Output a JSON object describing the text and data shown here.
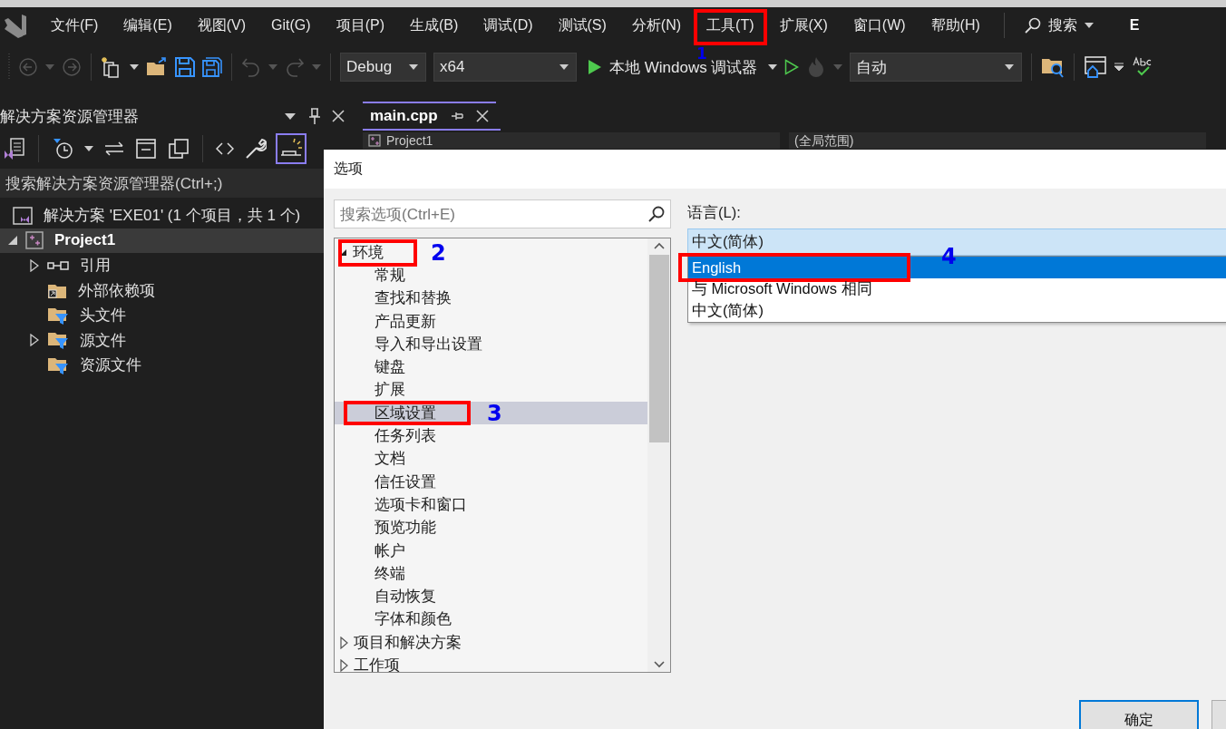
{
  "menu": {
    "items": [
      {
        "label": "文件(F)"
      },
      {
        "label": "编辑(E)"
      },
      {
        "label": "视图(V)"
      },
      {
        "label": "Git(G)"
      },
      {
        "label": "项目(P)"
      },
      {
        "label": "生成(B)"
      },
      {
        "label": "调试(D)"
      },
      {
        "label": "测试(S)"
      },
      {
        "label": "分析(N)"
      },
      {
        "label": "工具(T)",
        "callout": "1"
      },
      {
        "label": "扩展(X)"
      },
      {
        "label": "窗口(W)"
      },
      {
        "label": "帮助(H)"
      }
    ],
    "search": "搜索",
    "title": "E"
  },
  "toolbar": {
    "configuration": "Debug",
    "platform": "x64",
    "run_label": "本地 Windows 调试器",
    "target": "自动"
  },
  "solution_explorer": {
    "title": "解决方案资源管理器",
    "search": {
      "placeholder": "搜索解决方案资源管理器(Ctrl+;)"
    },
    "tree": [
      {
        "label": "解决方案 'EXE01' (1 个项目，共 1 个)",
        "kind": "solution",
        "selected": false,
        "children": [
          {
            "label": "Project1",
            "kind": "project",
            "expanded": true,
            "selected": true,
            "children": [
              {
                "label": "引用",
                "kind": "reference",
                "expanded": false,
                "selected": false
              },
              {
                "label": "外部依赖项",
                "kind": "external",
                "selected": false
              },
              {
                "label": "头文件",
                "kind": "filter",
                "selected": false
              },
              {
                "label": "源文件",
                "kind": "filter",
                "expanded": false,
                "selected": false
              },
              {
                "label": "资源文件",
                "kind": "filter",
                "selected": false
              }
            ]
          }
        ]
      }
    ]
  },
  "editor": {
    "tabs": [
      {
        "label": "main.cpp",
        "selected": true
      }
    ],
    "navigation": [
      "Project1",
      "(全局范围)"
    ]
  },
  "options_dialog": {
    "title": "选项",
    "search": {
      "placeholder": "搜索选项(Ctrl+E)"
    },
    "tree": [
      {
        "label": "环境",
        "expanded": true,
        "selected": false,
        "callout": "2",
        "children": [
          {
            "label": "常规",
            "selected": false
          },
          {
            "label": "查找和替换",
            "selected": false
          },
          {
            "label": "产品更新",
            "selected": false
          },
          {
            "label": "导入和导出设置",
            "selected": false
          },
          {
            "label": "键盘",
            "selected": false
          },
          {
            "label": "扩展",
            "selected": false
          },
          {
            "label": "区域设置",
            "selected": true,
            "callout": "3"
          },
          {
            "label": "任务列表",
            "selected": false
          },
          {
            "label": "文档",
            "selected": false
          },
          {
            "label": "信任设置",
            "selected": false
          },
          {
            "label": "选项卡和窗口",
            "selected": false
          },
          {
            "label": "预览功能",
            "selected": false
          },
          {
            "label": "帐户",
            "selected": false
          },
          {
            "label": "终端",
            "selected": false
          },
          {
            "label": "自动恢复",
            "selected": false
          },
          {
            "label": "字体和颜色",
            "selected": false
          }
        ]
      },
      {
        "label": "项目和解决方案",
        "expanded": false,
        "selected": false
      },
      {
        "label": "工作项",
        "expanded": false,
        "selected": false
      }
    ],
    "language": {
      "label": "语言(L):",
      "value": "中文(简体)",
      "options": [
        {
          "label": "English",
          "highlighted": true,
          "callout": "4"
        },
        {
          "label": "与 Microsoft Windows 相同",
          "highlighted": false
        },
        {
          "label": "中文(简体)",
          "highlighted": false
        }
      ]
    },
    "buttons": [
      "确定"
    ]
  }
}
